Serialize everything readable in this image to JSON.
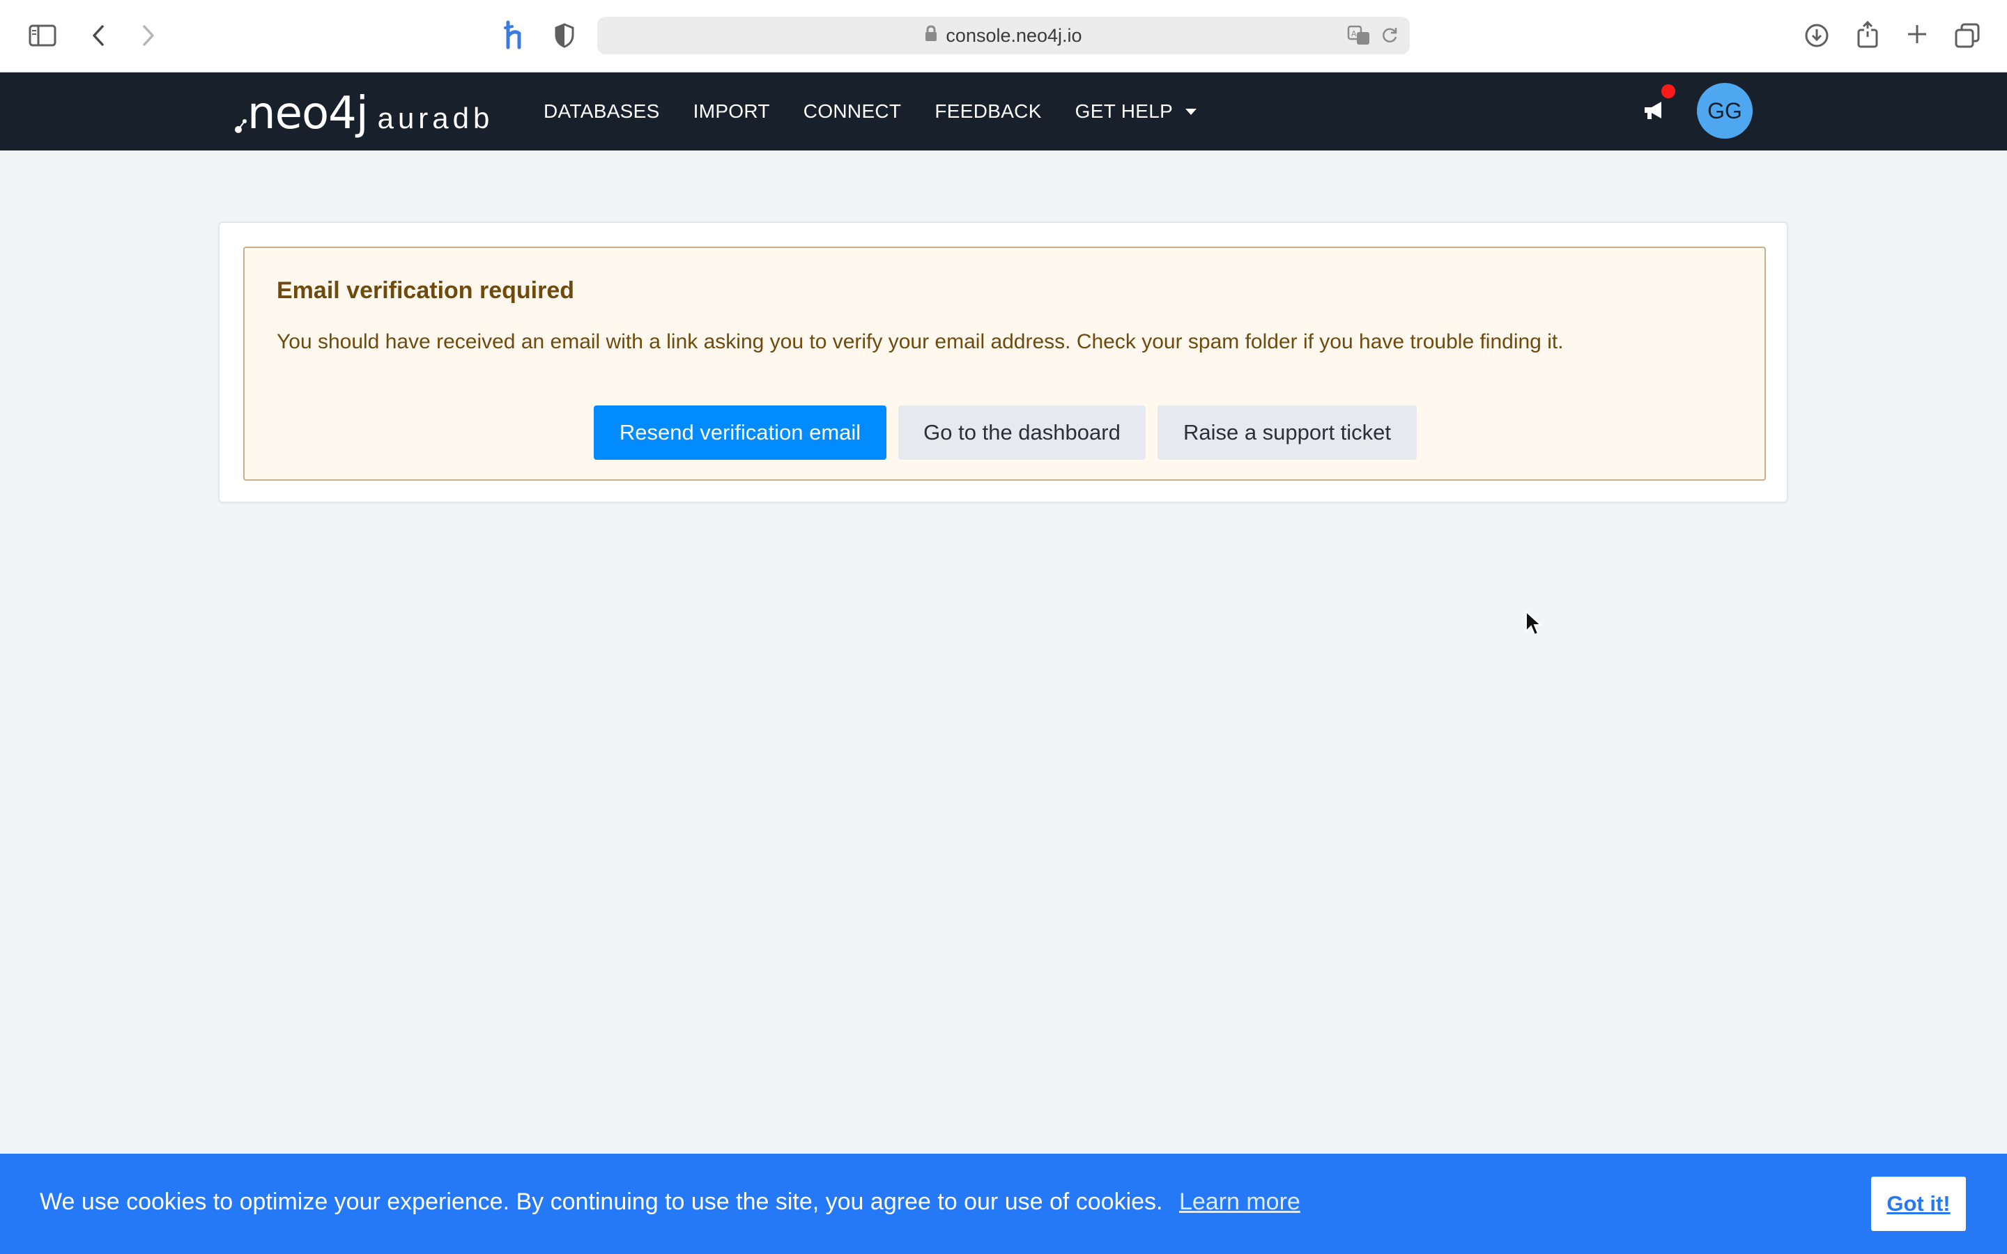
{
  "browser": {
    "url": "console.neo4j.io"
  },
  "app": {
    "logo_main": "neo4j",
    "logo_product": "auradb",
    "nav": [
      {
        "label": "DATABASES"
      },
      {
        "label": "IMPORT"
      },
      {
        "label": "CONNECT"
      },
      {
        "label": "FEEDBACK"
      },
      {
        "label": "GET HELP"
      }
    ],
    "avatar_initials": "GG",
    "notification_color": "#ff1a1a"
  },
  "alert": {
    "title": "Email verification required",
    "message": "You should have received an email with a link asking you to verify your email address. Check your spam folder if you have trouble finding it.",
    "buttons": {
      "resend": "Resend verification email",
      "dashboard": "Go to the dashboard",
      "support": "Raise a support ticket"
    }
  },
  "cookie": {
    "message": "We use cookies to optimize your experience. By continuing to use the site, you agree to our use of cookies.",
    "learn_more": "Learn more",
    "accept": "Got it!"
  },
  "colors": {
    "navbar": "#18202c",
    "primary": "#018bff",
    "cookie_banner": "#2679f6",
    "alert_bg": "#fff8ef",
    "alert_text": "#6f4a0d"
  }
}
